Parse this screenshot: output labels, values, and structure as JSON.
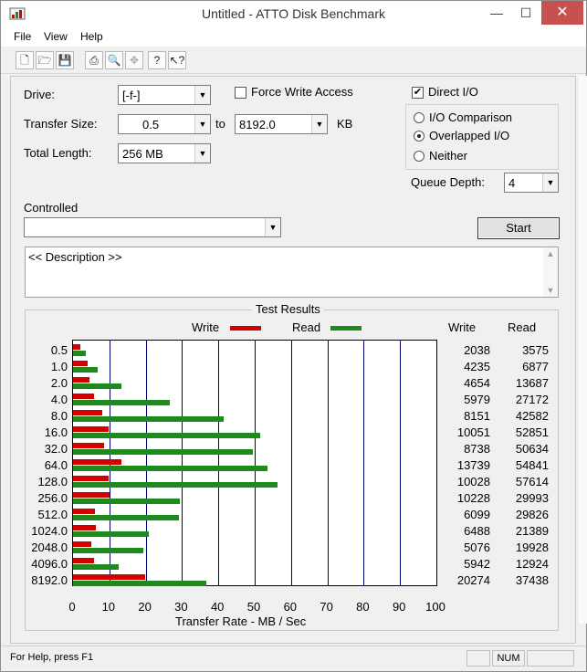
{
  "window": {
    "title": "Untitled - ATTO Disk Benchmark",
    "min_glyph": "—",
    "max_glyph": "☐",
    "close_glyph": "✕"
  },
  "menu": [
    {
      "label": "File",
      "underline": "F"
    },
    {
      "label": "View",
      "underline": "V"
    },
    {
      "label": "Help",
      "underline": "H"
    }
  ],
  "toolbar": [
    {
      "name": "new-icon",
      "glyph": "🗋",
      "enabled": true
    },
    {
      "name": "open-icon",
      "glyph": "🗁",
      "enabled": true
    },
    {
      "name": "save-icon",
      "glyph": "💾",
      "enabled": true
    },
    {
      "name": "print-icon",
      "glyph": "⎙",
      "enabled": true
    },
    {
      "name": "print-preview-icon",
      "glyph": "🔍",
      "enabled": true
    },
    {
      "name": "move-icon",
      "glyph": "✥",
      "enabled": false
    },
    {
      "name": "help-icon",
      "glyph": "?",
      "enabled": true
    },
    {
      "name": "context-help-icon",
      "glyph": "↖?",
      "enabled": true
    }
  ],
  "settings": {
    "drive_label": "Drive:",
    "drive_value": "[-f-]",
    "force_write_label": "Force Write Access",
    "force_write_checked": false,
    "direct_io_label": "Direct I/O",
    "direct_io_checked": true,
    "transfer_size_label": "Transfer Size:",
    "transfer_from": "0.5",
    "transfer_to_label": "to",
    "transfer_to": "8192.0",
    "transfer_unit": "KB",
    "total_length_label": "Total Length:",
    "total_length_value": "256 MB",
    "io_comparison_label": "I/O Comparison",
    "overlapped_io_label": "Overlapped I/O",
    "neither_label": "Neither",
    "selected_mode": "Overlapped I/O",
    "queue_depth_label": "Queue Depth:",
    "queue_depth_value": "4",
    "controlled_label": "Controlled",
    "controlled_value": "",
    "start_label": "Start",
    "description_text": "<< Description >>"
  },
  "results": {
    "title": "Test Results",
    "write_legend": "Write",
    "read_legend": "Read",
    "write_col_header": "Write",
    "read_col_header": "Read",
    "write_color": "#d40000",
    "read_color": "#1c8a1c"
  },
  "chart_data": {
    "type": "bar",
    "orientation": "horizontal",
    "xlabel": "Transfer Rate - MB / Sec",
    "xlim": [
      0,
      100
    ],
    "xticks": [
      "0",
      "10",
      "20",
      "30",
      "40",
      "50",
      "60",
      "70",
      "80",
      "90",
      "100"
    ],
    "categories": [
      "0.5",
      "1.0",
      "2.0",
      "4.0",
      "8.0",
      "16.0",
      "32.0",
      "64.0",
      "128.0",
      "256.0",
      "512.0",
      "1024.0",
      "2048.0",
      "4096.0",
      "8192.0"
    ],
    "series": [
      {
        "name": "Write",
        "values": [
          2038,
          4235,
          4654,
          5979,
          8151,
          10051,
          8738,
          13739,
          10028,
          10228,
          6099,
          6488,
          5076,
          5942,
          20274
        ]
      },
      {
        "name": "Read",
        "values": [
          3575,
          6877,
          13687,
          27172,
          42582,
          52851,
          50634,
          54841,
          57614,
          29993,
          29826,
          21389,
          19928,
          12924,
          37438
        ]
      }
    ],
    "bar_values_mb_per_sec": {
      "write": [
        1.99,
        4.14,
        4.54,
        5.84,
        7.96,
        9.82,
        8.53,
        13.42,
        9.79,
        9.99,
        5.96,
        6.34,
        4.96,
        5.8,
        19.8
      ],
      "read": [
        3.49,
        6.72,
        13.37,
        26.54,
        41.58,
        51.61,
        49.45,
        53.56,
        56.26,
        29.29,
        29.13,
        20.89,
        19.46,
        12.62,
        36.56
      ]
    },
    "grid": true,
    "legend": "top"
  },
  "status": {
    "help_text": "For Help, press F1",
    "num_text": "NUM"
  }
}
